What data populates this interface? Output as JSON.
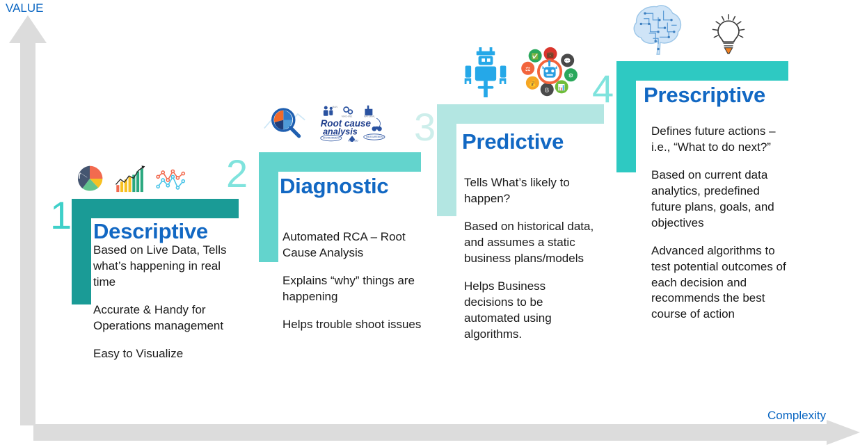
{
  "axes": {
    "value_label": "VALUE",
    "complexity_label": "Complexity",
    "axis_color": "#0a66c2",
    "arrow_color": "#dcdcdc"
  },
  "theme": {
    "title_color": "#1268c3",
    "body_color": "#1a1a1a",
    "background": "#ffffff"
  },
  "steps": [
    {
      "number": "1",
      "title": "Descriptive",
      "bar_color": "#1a9b96",
      "number_color": "#3fd0c9",
      "paragraphs": [
        "Based on Live Data, Tells what’s happening in real time",
        "Accurate & Handy for Operations management",
        "Easy to Visualize"
      ],
      "icons": [
        "pie-chart-icon",
        "bar-chart-trend-icon",
        "line-scatter-chart-icon"
      ]
    },
    {
      "number": "2",
      "title": "Diagnostic",
      "bar_color": "#63d4cd",
      "number_color": "#7fe3dd",
      "paragraphs": [
        "Automated RCA – Root Cause Analysis",
        "Explains “why” things are happening",
        "Helps trouble shoot issues"
      ],
      "icons": [
        "magnifier-pie-chart-icon",
        "root-cause-analysis-wordart-icon"
      ]
    },
    {
      "number": "3",
      "title": "Predictive",
      "bar_color": "#b3e6e2",
      "number_color": "#cdeeeb",
      "paragraphs": [
        "Tells What’s likely to happen?",
        "Based on historical data, and assumes a static business plans/models",
        "Helps Business decisions to be automated using algorithms."
      ],
      "icons": [
        "robot-icon",
        "chatbot-services-icon"
      ]
    },
    {
      "number": "4",
      "title": "Prescriptive",
      "bar_color": "#2ec9c2",
      "number_color": "#7fe3dd",
      "paragraphs": [
        "Defines future actions – i.e., “What to do next?”",
        "Based on current data analytics, predefined future plans, goals, and objectives",
        "Advanced algorithms to test potential outcomes of each decision and recommends the best course of action"
      ],
      "icons": [
        "ai-brain-circuit-icon",
        "lightbulb-idea-icon"
      ]
    }
  ]
}
